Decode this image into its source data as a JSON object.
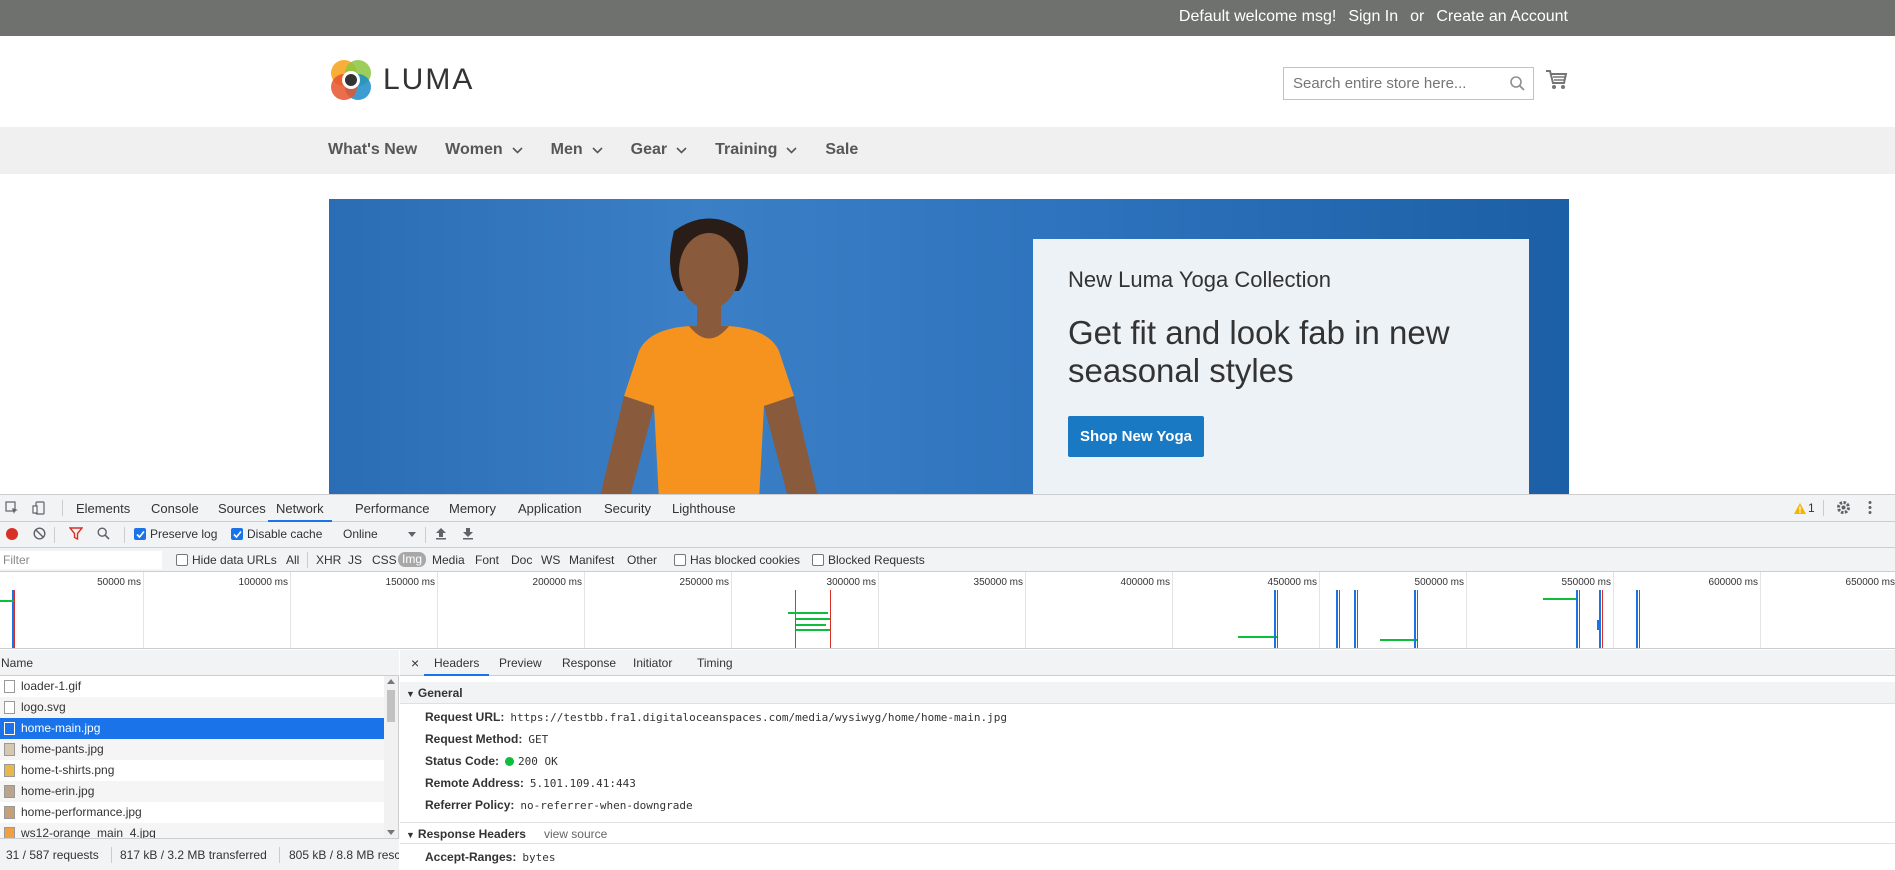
{
  "site": {
    "topbar": {
      "welcome": "Default welcome msg!",
      "sign_in": "Sign In",
      "or": "or",
      "create_account": "Create an Account"
    },
    "logo_text": "LUMA",
    "search": {
      "placeholder": "Search entire store here..."
    },
    "nav": [
      "What's New",
      "Women",
      "Men",
      "Gear",
      "Training",
      "Sale"
    ],
    "hero": {
      "subtitle": "New Luma Yoga Collection",
      "headline": "Get fit and look fab in new seasonal styles",
      "button": "Shop New Yoga"
    },
    "colors": {
      "topbar": "#6e716e",
      "nav_bg": "#f0f0f0",
      "primary_button": "#1979c3",
      "hero_bg": "#2b6db5"
    }
  },
  "devtools": {
    "tabs": [
      "Elements",
      "Console",
      "Sources",
      "Network",
      "Performance",
      "Memory",
      "Application",
      "Security",
      "Lighthouse"
    ],
    "active_tab": "Network",
    "warning_count": "1",
    "toolbar": {
      "preserve_log": "Preserve log",
      "disable_cache": "Disable cache",
      "throttle": "Online"
    },
    "filter": {
      "placeholder": "Filter",
      "hide_data_urls": "Hide data URLs",
      "types": [
        "All",
        "XHR",
        "JS",
        "CSS",
        "Img",
        "Media",
        "Font",
        "Doc",
        "WS",
        "Manifest",
        "Other"
      ],
      "selected_type": "Img",
      "has_blocked_cookies": "Has blocked cookies",
      "blocked_requests": "Blocked Requests"
    },
    "timeline_ticks": [
      "50000 ms",
      "100000 ms",
      "150000 ms",
      "200000 ms",
      "250000 ms",
      "300000 ms",
      "350000 ms",
      "400000 ms",
      "450000 ms",
      "500000 ms",
      "550000 ms",
      "600000 ms",
      "650000 ms"
    ],
    "name_header": "Name",
    "requests": [
      "loader-1.gif",
      "logo.svg",
      "home-main.jpg",
      "home-pants.jpg",
      "home-t-shirts.png",
      "home-erin.jpg",
      "home-performance.jpg",
      "ws12-orange_main_4.jpg"
    ],
    "selected_request": "home-main.jpg",
    "status": {
      "requests": "31 / 587 requests",
      "transferred": "817 kB / 3.2 MB transferred",
      "resources": "805 kB / 8.8 MB resc"
    },
    "detail_tabs": [
      "Headers",
      "Preview",
      "Response",
      "Initiator",
      "Timing"
    ],
    "general": {
      "title": "General",
      "request_url_label": "Request URL:",
      "request_url": "https://testbb.fra1.digitaloceanspaces.com/media/wysiwyg/home/home-main.jpg",
      "method_label": "Request Method:",
      "method": "GET",
      "status_label": "Status Code:",
      "status": "200 OK",
      "remote_label": "Remote Address:",
      "remote": "5.101.109.41:443",
      "referrer_label": "Referrer Policy:",
      "referrer": "no-referrer-when-downgrade"
    },
    "response_headers": {
      "title": "Response Headers",
      "view_source": "view source",
      "accept_ranges_label": "Accept-Ranges:",
      "accept_ranges": "bytes"
    }
  }
}
